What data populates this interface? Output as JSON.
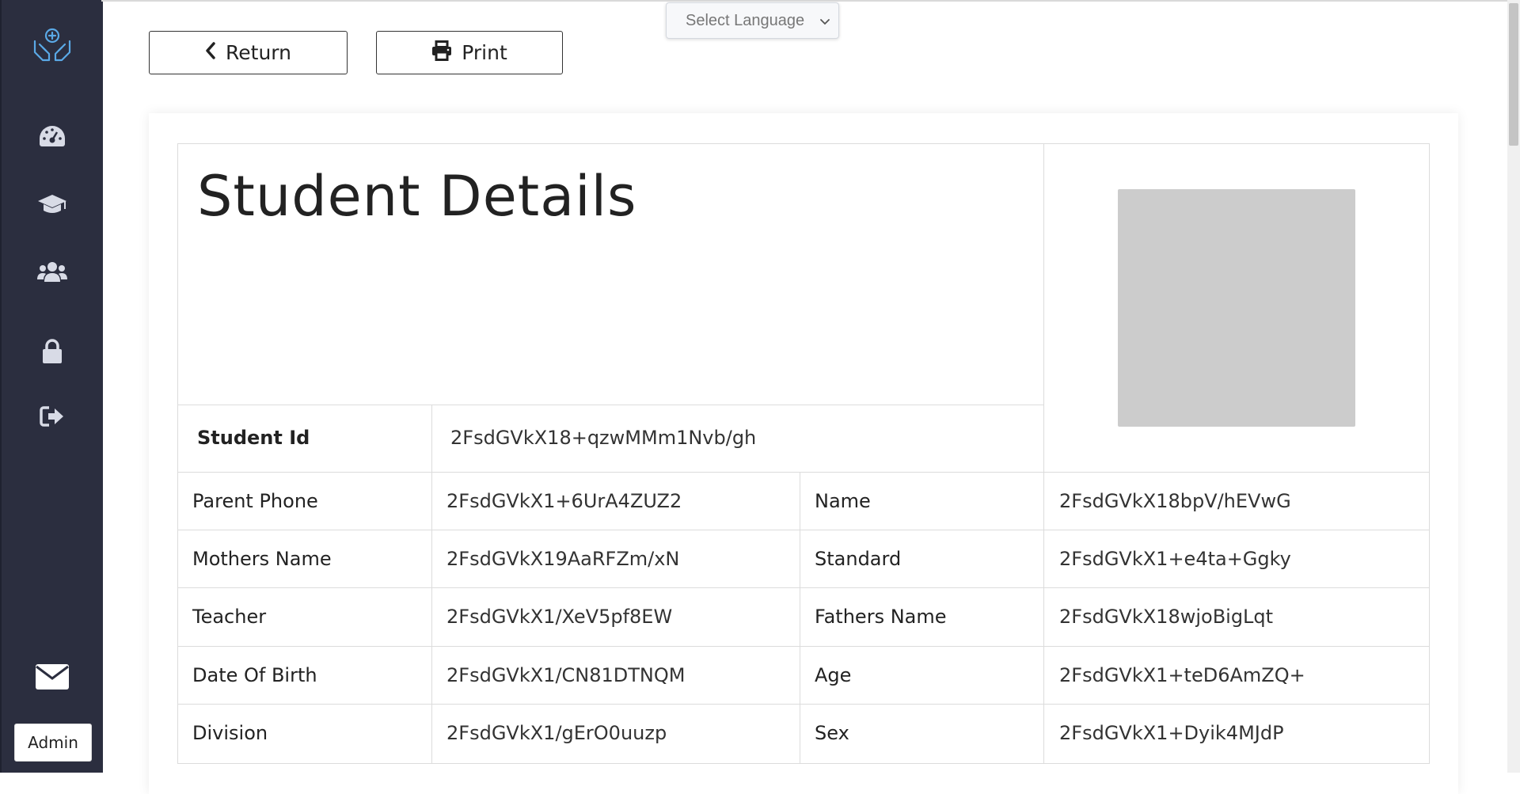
{
  "sidebar": {
    "nav": [
      {
        "icon": "dashboard-gauge-icon"
      },
      {
        "icon": "graduation-cap-icon"
      },
      {
        "icon": "users-group-icon"
      },
      {
        "icon": "lock-icon"
      },
      {
        "icon": "sign-out-icon"
      }
    ],
    "mail_icon": "envelope-icon",
    "admin_label": "Admin"
  },
  "toolbar": {
    "return_label": "Return",
    "print_label": "Print"
  },
  "language": {
    "placeholder": "Select Language"
  },
  "details": {
    "title": "Student Details",
    "student_id_label": "Student Id",
    "student_id_value": "2FsdGVkX18+qzwMMm1Nvb/gh",
    "rows": [
      {
        "l1": "Parent Phone",
        "v1": "2FsdGVkX1+6UrA4ZUZ2",
        "l2": "Name",
        "v2": "2FsdGVkX18bpV/hEVwG"
      },
      {
        "l1": "Mothers Name",
        "v1": "2FsdGVkX19AaRFZm/xN",
        "l2": "Standard",
        "v2": "2FsdGVkX1+e4ta+Ggky"
      },
      {
        "l1": "Teacher",
        "v1": "2FsdGVkX1/XeV5pf8EW",
        "l2": "Fathers Name",
        "v2": "2FsdGVkX18wjoBigLqt"
      },
      {
        "l1": "Date Of Birth",
        "v1": "2FsdGVkX1/CN81DTNQM",
        "l2": "Age",
        "v2": "2FsdGVkX1+teD6AmZQ+"
      },
      {
        "l1": "Division",
        "v1": "2FsdGVkX1/gErO0uuzp",
        "l2": "Sex",
        "v2": "2FsdGVkX1+Dyik4MJdP"
      }
    ]
  },
  "colors": {
    "sidebar_bg": "#2b2e3f",
    "icon_color": "#d8dbe6",
    "logo_color": "#5aa9e6",
    "photo_placeholder": "#cccccc"
  }
}
